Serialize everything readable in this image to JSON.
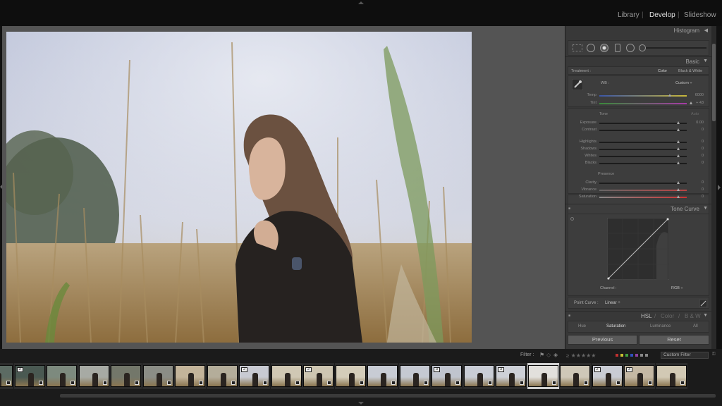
{
  "modules": [
    "Library",
    "Develop",
    "Slideshow"
  ],
  "active_module": "Develop",
  "panels": {
    "histogram": {
      "title": "Histogram"
    },
    "basic": {
      "title": "Basic",
      "treatment_label": "Treatment :",
      "treatment_color": "Color",
      "treatment_bw": "Black & White",
      "wb_label": "WB :",
      "wb_value": "Custom ÷",
      "temp": {
        "label": "Temp",
        "value": "6000"
      },
      "tint": {
        "label": "Tint",
        "value": "+ 43"
      },
      "tone_label": "Tone",
      "auto_label": "Auto",
      "exposure": {
        "label": "Exposure",
        "value": "0.00"
      },
      "contrast": {
        "label": "Contrast",
        "value": "0"
      },
      "highlights": {
        "label": "Highlights",
        "value": "0"
      },
      "shadows": {
        "label": "Shadows",
        "value": "0"
      },
      "whites": {
        "label": "Whites",
        "value": "0"
      },
      "blacks": {
        "label": "Blacks",
        "value": "0"
      },
      "presence_label": "Presence",
      "clarity": {
        "label": "Clarity",
        "value": "0"
      },
      "vibrance": {
        "label": "Vibrance",
        "value": "0"
      },
      "saturation": {
        "label": "Saturation",
        "value": "0"
      }
    },
    "tone_curve": {
      "title": "Tone Curve",
      "channel_label": "Channel :",
      "channel_value": "RGB ÷",
      "point_curve_label": "Point Curve :",
      "point_curve_value": "Linear ÷"
    },
    "hsl": {
      "title": "HSL",
      "sep1": "/",
      "color": "Color",
      "sep2": "/",
      "bw": "B & W",
      "tabs": [
        "Hue",
        "Saturation",
        "Luminance",
        "All"
      ],
      "active_tab": "Saturation"
    }
  },
  "buttons": {
    "previous": "Previous",
    "reset": "Reset"
  },
  "filter": {
    "label": "Filter :",
    "custom_filter": "Custom Filter",
    "color_labels": [
      "#c03030",
      "#c8c030",
      "#40a040",
      "#3050c0",
      "#9040a0",
      "#888888",
      "#888888"
    ]
  },
  "filmstrip": {
    "badges": [
      "3",
      "",
      "",
      "",
      "",
      "",
      "",
      "2",
      "",
      "2",
      "",
      "",
      "",
      "3",
      "",
      "3",
      "",
      "",
      "2",
      "3",
      ""
    ],
    "selected_index": 17,
    "thumb_tones": [
      "#5c6b63",
      "#4a5952",
      "#7d8a7e",
      "#a7aaa4",
      "#73776a",
      "#8b8d86",
      "#c3b49a",
      "#b4ad9a",
      "#c8cad2",
      "#d0c8b4",
      "#cec6b2",
      "#d4cdba",
      "#c8ccd4",
      "#c5c9d2",
      "#c0c4ce",
      "#c9cdd6",
      "#cdd0d7",
      "#e2e0dc",
      "#cfc8b8",
      "#c9ccd4",
      "#c4b8a4",
      "#d2c9b4"
    ]
  }
}
